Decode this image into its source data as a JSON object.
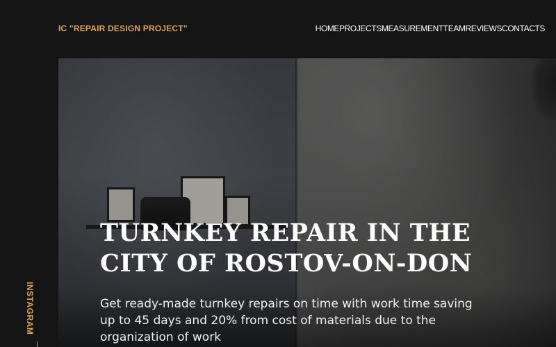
{
  "header": {
    "brand": "IC \"REPAIR DESIGN PROJECT\"",
    "nav": [
      {
        "label": "HOME"
      },
      {
        "label": "PROJECTS"
      },
      {
        "label": "MEASUREMENT"
      },
      {
        "label": "TEAM"
      },
      {
        "label": "REVIEWS"
      },
      {
        "label": "CONTACTS"
      }
    ]
  },
  "hero": {
    "title": "TURNKEY REPAIR IN THE CITY OF ROSTOV-ON-DON",
    "subtitle": "Get ready-made turnkey repairs on time with work time saving up to 45 days and 20% from cost of materials due to the organization of work",
    "image": "interior-photo"
  },
  "sidebar": {
    "social": [
      {
        "label": "INSTAGRAM",
        "icon": "instagram-link"
      }
    ]
  },
  "colors": {
    "background": "#141414",
    "accent": "#e3a35c",
    "text": "#ffffff"
  }
}
